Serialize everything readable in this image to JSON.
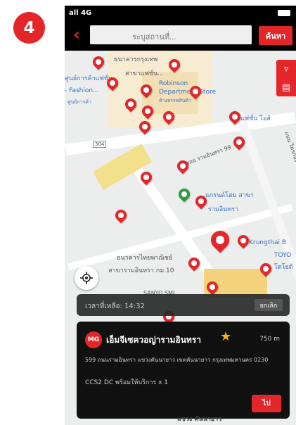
{
  "step_badge": "4",
  "status": {
    "signal": "all 4G"
  },
  "header": {
    "back_icon": "chevron-left-icon",
    "search_placeholder": "ระบุสถานที่...",
    "search_button": "ค้นหา"
  },
  "map": {
    "labels": {
      "bank_krungthep": "ธนาคารกรุงเทพ",
      "bank_krungthep_branch": "สาขาแฟชั่น...",
      "fashion1": "ศูนย์การค้าแฟชั่น",
      "fashion2": "- Fashion...",
      "fashion3": "ศูนย์การค้า",
      "robinson1": "Robinson",
      "robinson2": "Department Store",
      "robinson3": "ห้างสรรพสินค้า",
      "fashion_island": "แฟชั่น ไอส์",
      "road_code": "304",
      "soi": "ซอย รามอินทรา 99",
      "grand_home1": "แกรนด์โฮม สาขา",
      "grand_home2": "รามอินทรา",
      "krungthai": "Krungthai B",
      "thaipanich1": "ธนาคารไทยพาณิชย์",
      "thaipanich2": "สาขารามอินทรา กม.10",
      "toyota1": "TOYO",
      "toyota2": "โตโยต้",
      "sanyo": "SANYO SMI",
      "right_road": "ถนน ไตรกอง"
    },
    "side_tools": [
      "filter-icon",
      "list-icon"
    ]
  },
  "timer": {
    "label": "เวลาที่เหลือ: 14:32",
    "cancel": "ยกเลิก"
  },
  "station": {
    "logo_text": "MG",
    "name": "เอ็มจีเซควอญ่ารามอินทรา",
    "distance": "750 m",
    "address": "599 ถนนรามอินทรา แขวงคันนายาว เขตคันนายาว กรุงเทพมหานคร 0230",
    "charger": "CCS2  DC    พร้อมให้บริการ x 1",
    "go_button": "ไป"
  },
  "bottom_street": "แขวง คันนายาว",
  "colors": {
    "accent": "#e3262a",
    "pin_user": "#2e9b3a"
  }
}
